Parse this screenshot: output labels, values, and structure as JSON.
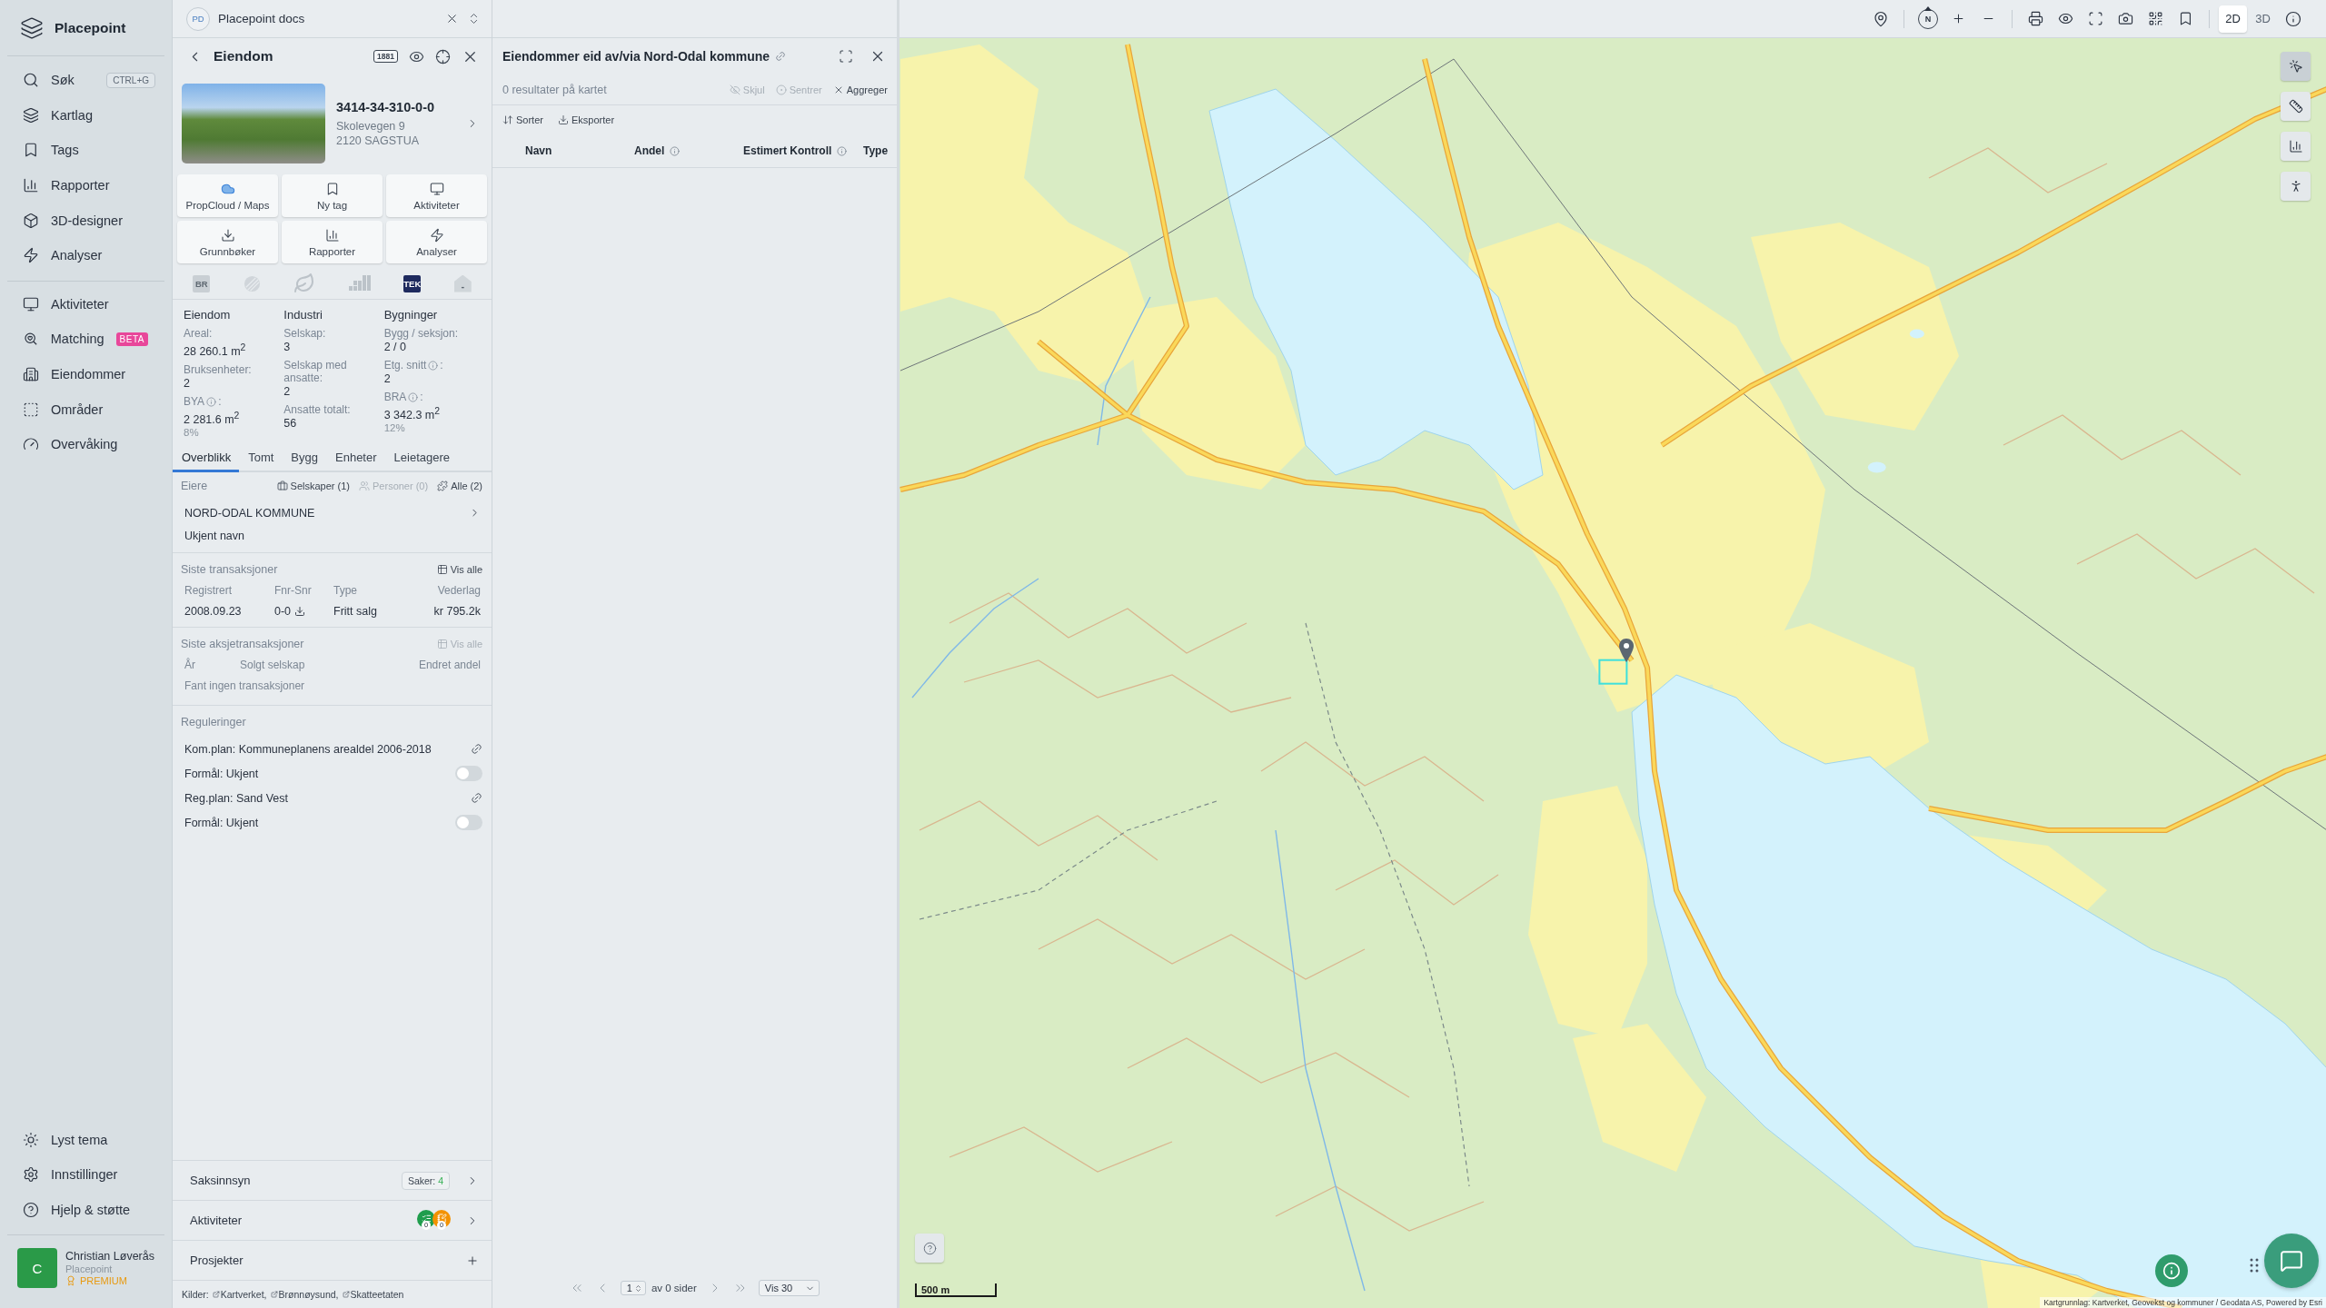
{
  "sidebar": {
    "brand": "Placepoint",
    "nav_main": [
      {
        "label": "Søk",
        "shortcut": "CTRL+G"
      },
      {
        "label": "Kartlag"
      },
      {
        "label": "Tags"
      },
      {
        "label": "Rapporter"
      },
      {
        "label": "3D-designer"
      },
      {
        "label": "Analyser"
      }
    ],
    "nav_secondary": [
      {
        "label": "Aktiviteter"
      },
      {
        "label": "Matching",
        "badge": "BETA"
      },
      {
        "label": "Eiendommer"
      },
      {
        "label": "Områder"
      },
      {
        "label": "Overvåking"
      }
    ],
    "nav_bottom": [
      {
        "label": "Lyst tema"
      },
      {
        "label": "Innstillinger"
      },
      {
        "label": "Hjelp & støtte"
      }
    ],
    "user": {
      "initial": "C",
      "name": "Christian Løverås",
      "organization": "Placepoint",
      "plan": "PREMIUM"
    }
  },
  "workspace_tab": {
    "initials": "PD",
    "title": "Placepoint docs"
  },
  "property_panel": {
    "title": "Eiendom",
    "header_badge": "1881",
    "property_id": "3414-34-310-0-0",
    "address_lines": [
      "Skolevegen 9",
      "2120 SAGSTUA"
    ],
    "actions": [
      {
        "label": "PropCloud / Maps"
      },
      {
        "label": "Ny tag"
      },
      {
        "label": "Aktiviteter"
      },
      {
        "label": "Grunnbøker"
      },
      {
        "label": "Rapporter"
      },
      {
        "label": "Analyser"
      }
    ],
    "source_badges": [
      {
        "kind": "text",
        "label": "BR",
        "enabled": false
      },
      {
        "kind": "icon",
        "enabled": false
      },
      {
        "kind": "icon",
        "enabled": false
      },
      {
        "kind": "icon",
        "enabled": false
      },
      {
        "kind": "text",
        "label": "TEK",
        "enabled": true
      },
      {
        "kind": "house",
        "label": "-",
        "enabled": false
      }
    ],
    "stats": [
      {
        "heading": "Eiendom",
        "fields": [
          {
            "label": "Areal:",
            "info": false,
            "value": "28 260.1 m$^{2}$"
          },
          {
            "label": "Bruksenheter:",
            "info": false,
            "value": "2"
          },
          {
            "label": "BYA",
            "info": true,
            "label_suffix": ":",
            "value": "2 281.6 m$^{2}$",
            "note": "8%"
          }
        ]
      },
      {
        "heading": "Industri",
        "fields": [
          {
            "label": "Selskap:",
            "info": false,
            "value": "3"
          },
          {
            "label": "Selskap med ansatte:",
            "info": false,
            "value": "2"
          },
          {
            "label": "Ansatte totalt:",
            "info": false,
            "value": "56"
          }
        ]
      },
      {
        "heading": "Bygninger",
        "fields": [
          {
            "label": "Bygg / seksjon:",
            "info": false,
            "value": "2 / 0"
          },
          {
            "label": "Etg. snitt",
            "info": true,
            "label_suffix": ":",
            "value": "2"
          },
          {
            "label": "BRA",
            "info": true,
            "label_suffix": ":",
            "value": "3 342.3 m$^{2}$",
            "note": "12%"
          }
        ]
      }
    ],
    "tabs": [
      {
        "label": "Overblikk",
        "selected": true
      },
      {
        "label": "Tomt",
        "selected": false
      },
      {
        "label": "Bygg",
        "selected": false
      },
      {
        "label": "Enheter",
        "selected": false
      },
      {
        "label": "Leietagere",
        "selected": false
      }
    ],
    "owners": {
      "label": "Eiere",
      "filters": [
        {
          "label": "Selskaper (1)",
          "disabled": false
        },
        {
          "label": "Personer (0)",
          "disabled": true
        },
        {
          "label": "Alle (2)",
          "disabled": false
        }
      ],
      "items": [
        {
          "name": "NORD-ODAL KOMMUNE",
          "openable": true
        },
        {
          "name": "Ukjent navn",
          "openable": false
        }
      ]
    },
    "transactions": {
      "title": "Siste transaksjoner",
      "action": {
        "label": "Vis alle",
        "disabled": false
      },
      "columns": [
        "Registrert",
        "Fnr-Snr",
        "Type",
        "Vederlag"
      ],
      "rows": [
        [
          {
            "text": "2008.09.23",
            "download": false
          },
          {
            "text": "0-0",
            "download": true
          },
          {
            "text": "Fritt salg",
            "download": false
          },
          {
            "text": "kr 795.2k",
            "download": false
          }
        ]
      ]
    },
    "share_transactions": {
      "title": "Siste aksjetransaksjoner",
      "action": {
        "label": "Vis alle",
        "disabled": true
      },
      "columns": [
        "År",
        "Solgt selskap",
        "Endret andel"
      ],
      "empty_message": "Fant ingen transaksjoner"
    },
    "regulations": {
      "title": "Reguleringer",
      "items": [
        {
          "kind": "plan",
          "text": "Kom.plan: Kommuneplanens arealdel 2006-2018"
        },
        {
          "kind": "purpose",
          "text": "Formål: Ukjent",
          "on": false
        },
        {
          "kind": "plan",
          "text": "Reg.plan: Sand Vest"
        },
        {
          "kind": "purpose",
          "text": "Formål: Ukjent",
          "on": false
        }
      ]
    },
    "sections": [
      {
        "kind": "cases",
        "label": "Saksinnsyn",
        "badge_label": "Saker:",
        "badge_count": "4"
      },
      {
        "kind": "activities",
        "label": "Aktiviteter",
        "counters": [
          {
            "count": "0",
            "color": "#1f9d4c"
          },
          {
            "count": "0",
            "color": "#f39200"
          }
        ]
      },
      {
        "kind": "add",
        "label": "Prosjekter"
      }
    ],
    "sources": {
      "label": "Kilder:",
      "links": [
        "Kartverket,",
        "Brønnøysund,",
        "Skatteetaten"
      ]
    }
  },
  "results_panel": {
    "title": "Eiendommer eid av/via Nord-Odal kommune",
    "count": "0 resultater på kartet",
    "actions": [
      {
        "label": "Skjul",
        "disabled": true
      },
      {
        "label": "Sentrer",
        "disabled": true
      },
      {
        "label": "Aggreger",
        "disabled": false
      }
    ],
    "tools": [
      {
        "label": "Sorter"
      },
      {
        "label": "Eksporter"
      }
    ],
    "columns": [
      {
        "label": "Navn",
        "info": false
      },
      {
        "label": "Andel",
        "info": true
      },
      {
        "label": "Estimert Kontroll",
        "info": true
      },
      {
        "label": "Type",
        "info": false
      }
    ],
    "pagination": {
      "page": "1",
      "of_label": "av 0 sider",
      "page_size": "Vis 30"
    }
  },
  "map": {
    "compass_label": "N",
    "view_modes": [
      {
        "label": "2D",
        "selected": true
      },
      {
        "label": "3D",
        "selected": false
      }
    ],
    "side_tools": [
      {
        "selected": true
      },
      {
        "selected": false
      },
      {
        "selected": false
      },
      {
        "selected": false
      }
    ],
    "scale_label": "500 m",
    "attribution": "Kartgrunnlag: Kartverket, Geovekst og kommuner / Geodata AS, Powered by Esri"
  }
}
